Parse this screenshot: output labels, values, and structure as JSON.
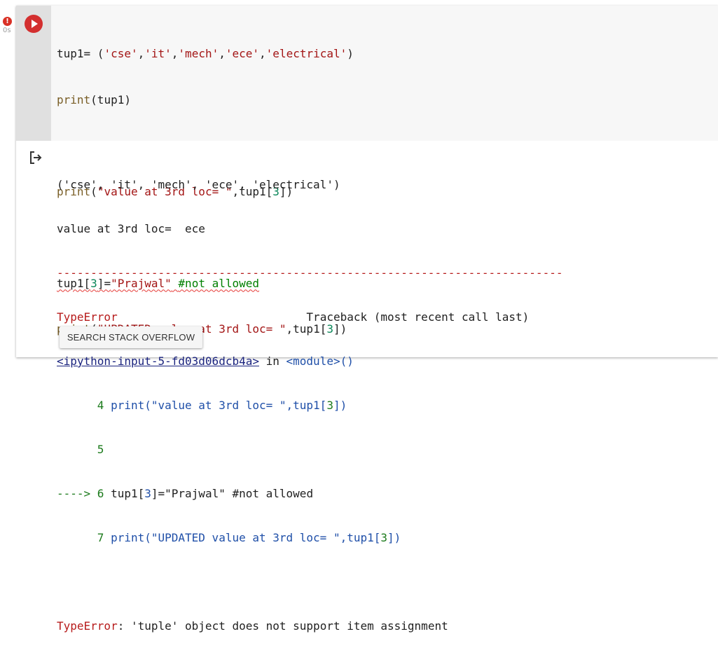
{
  "status": {
    "error_badge": "!",
    "exec_time": "0s"
  },
  "icons": {
    "run": "play-icon",
    "output": "output-exit-icon",
    "error": "error-badge-icon"
  },
  "colors": {
    "run_button": "#d32f2f",
    "error_badge": "#d93025",
    "code_background": "#f7f7f7",
    "gutter_background": "#e0e0e0"
  },
  "code": {
    "line1": {
      "a": "tup1= (",
      "s1": "'cse'",
      "c1": ",",
      "s2": "'it'",
      "c2": ",",
      "s3": "'mech'",
      "c3": ",",
      "s4": "'ece'",
      "c4": ",",
      "s5": "'electrical'",
      "end": ")"
    },
    "line2": {
      "fn": "print",
      "rest": "(tup1)"
    },
    "line3": {
      "fn": "print",
      "p": "(",
      "s": "\"value at 3rd loc= \"",
      "rest": ",tup1[",
      "n": "3",
      "end": "])"
    },
    "line4": {
      "a": "tup1[",
      "n": "3",
      "b": "]=",
      "s": "\"Prajwal\"",
      "sp": " ",
      "cmt": "#not allowed"
    },
    "line5": {
      "fn": "print",
      "p": "(",
      "s": "\"UPDATED value at 3rd loc= \"",
      "rest": ",tup1[",
      "n": "3",
      "end": "])"
    }
  },
  "output": {
    "tuple_line": "('cse', 'it', 'mech', 'ece', 'electrical')",
    "value_line": "value at 3rd loc=  ece",
    "dashes": "---------------------------------------------------------------------------",
    "err_type": "TypeError",
    "traceback_header": "                            Traceback (most recent call last)",
    "input_ref": "<ipython-input-5-fd03d06dcb4a>",
    "in_text": " in ",
    "module": "<module>",
    "module_paren": "()",
    "tb4": {
      "num": "      4 ",
      "fn": "print(",
      "s": "\"value at 3rd loc= \"",
      "rest": ",tup1[",
      "n": "3",
      "end": "])"
    },
    "tb5": {
      "num": "      5"
    },
    "tb6": {
      "arrow": "----> 6 ",
      "a": "tup1[",
      "n": "3",
      "b": "]=",
      "s": "\"Prajwal\"",
      "cmt": " #not allowed"
    },
    "tb7": {
      "num": "      7 ",
      "fn": "print(",
      "s": "\"UPDATED value at 3rd loc= \"",
      "rest": ",tup1[",
      "n": "3",
      "end": "])"
    },
    "final_type": "TypeError",
    "final_msg": ": 'tuple' object does not support item assignment"
  },
  "actions": {
    "search_stack_overflow": "SEARCH STACK OVERFLOW"
  }
}
